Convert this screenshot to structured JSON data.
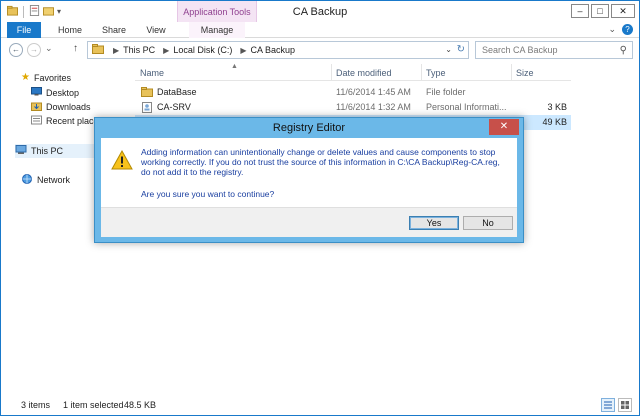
{
  "window": {
    "title": "CA Backup",
    "context_tab": "Application Tools",
    "controls": {
      "minimize": "–",
      "maximize": "□",
      "close": "✕"
    }
  },
  "ribbon": {
    "tabs": [
      "File",
      "Home",
      "Share",
      "View",
      "Manage"
    ],
    "collapse_glyph": "⌄",
    "help_glyph": "?"
  },
  "address": {
    "crumbs": [
      "This PC",
      "Local Disk (C:)",
      "CA Backup"
    ],
    "separator": "▶",
    "search_placeholder": "Search CA Backup"
  },
  "nav": {
    "back": "←",
    "forward": "→",
    "recent": "⌄",
    "up": "↑",
    "favorites": "Favorites",
    "desktop": "Desktop",
    "downloads": "Downloads",
    "recent_places": "Recent places",
    "this_pc": "This PC",
    "network": "Network"
  },
  "columns": {
    "name": "Name",
    "date": "Date modified",
    "type": "Type",
    "size": "Size"
  },
  "files": [
    {
      "name": "DataBase",
      "date": "11/6/2014 1:45 AM",
      "type": "File folder",
      "size": ""
    },
    {
      "name": "CA-SRV",
      "date": "11/6/2014 1:32 AM",
      "type": "Personal Informati...",
      "size": "3 KB"
    },
    {
      "name": "",
      "date": "",
      "type": "",
      "size": "49 KB"
    }
  ],
  "status": {
    "count": "3 items",
    "selected": "1 item selected",
    "size": "48.5 KB"
  },
  "dialog": {
    "title": "Registry Editor",
    "message": "Adding information can unintentionally change or delete values and cause components to stop working correctly. If you do not trust the source of this information in C:\\CA Backup\\Reg-CA.reg, do not add it to the registry.",
    "question": "Are you sure you want to continue?",
    "yes": "Yes",
    "no": "No",
    "close": "✕"
  },
  "colors": {
    "accent": "#1979ca",
    "context_tab": "#8f3f8f",
    "dialog_frame": "#6bb8e8",
    "dialog_text": "#1a3fa0",
    "selection": "#cce8ff",
    "close_red": "#c7504a"
  }
}
